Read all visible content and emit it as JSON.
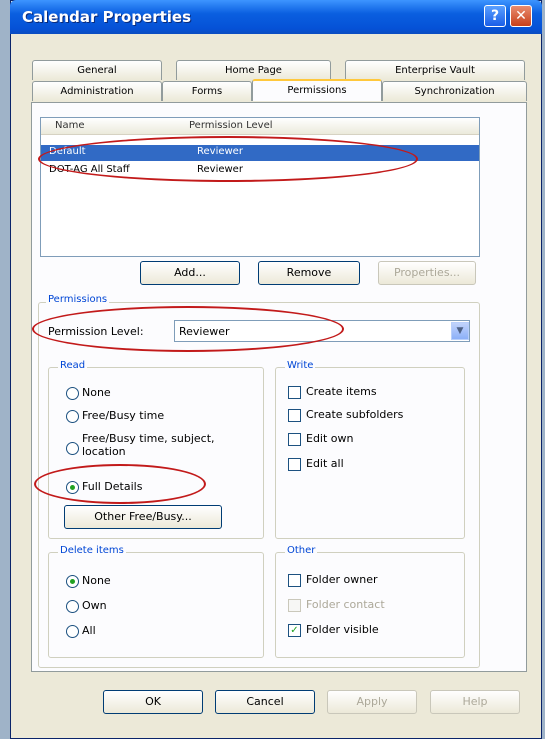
{
  "window": {
    "title": "Calendar Properties"
  },
  "tabs_row1": [
    "General",
    "Home Page",
    "Enterprise Vault"
  ],
  "tabs_row2": [
    "Administration",
    "Forms",
    "Permissions",
    "Synchronization"
  ],
  "list": {
    "headers": [
      "Name",
      "Permission Level"
    ],
    "rows": [
      {
        "name": "Default",
        "level": "Reviewer",
        "selected": true
      },
      {
        "name": "DOT-AG All Staff",
        "level": "Reviewer",
        "selected": false
      }
    ]
  },
  "list_buttons": {
    "add": "Add...",
    "remove": "Remove",
    "properties": "Properties..."
  },
  "permissions": {
    "legend": "Permissions",
    "level_label": "Permission Level:",
    "level_value": "Reviewer",
    "read": {
      "legend": "Read",
      "options": [
        "None",
        "Free/Busy time",
        "Free/Busy time, subject, location",
        "Full Details"
      ],
      "selected": "Full Details",
      "other_button": "Other Free/Busy..."
    },
    "write": {
      "legend": "Write",
      "options": [
        "Create items",
        "Create subfolders",
        "Edit own",
        "Edit all"
      ]
    },
    "delete": {
      "legend": "Delete items",
      "options": [
        "None",
        "Own",
        "All"
      ],
      "selected": "None"
    },
    "other": {
      "legend": "Other",
      "folder_owner": "Folder owner",
      "folder_contact": "Folder contact",
      "folder_visible": "Folder visible",
      "folder_visible_checked": true
    }
  },
  "dialog_buttons": {
    "ok": "OK",
    "cancel": "Cancel",
    "apply": "Apply",
    "help": "Help"
  },
  "colors": {
    "title_bar": "#0551d6",
    "selection": "#316ac5",
    "annotation": "#c21a1a"
  }
}
